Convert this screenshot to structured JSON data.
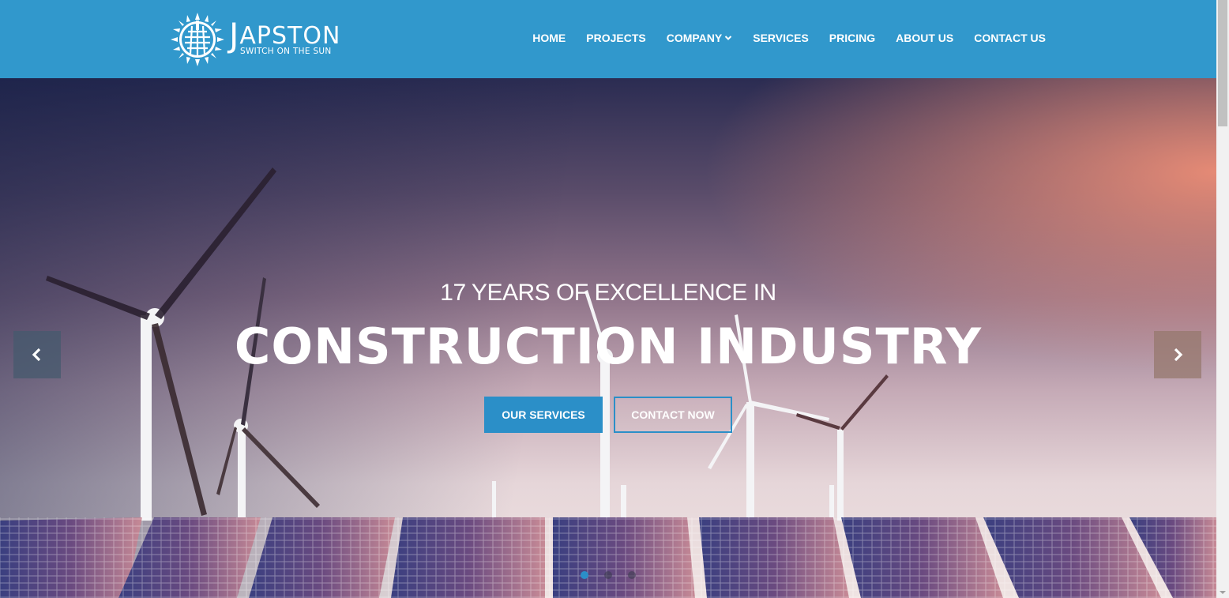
{
  "brand": {
    "name": "APSTON",
    "initial": "J",
    "tagline": "SWITCH ON THE SUN"
  },
  "nav": {
    "items": [
      {
        "label": "HOME"
      },
      {
        "label": "PROJECTS"
      },
      {
        "label": "COMPANY",
        "has_dropdown": true
      },
      {
        "label": "SERVICES"
      },
      {
        "label": "PRICING"
      },
      {
        "label": "ABOUT US"
      },
      {
        "label": "CONTACT US"
      }
    ]
  },
  "hero": {
    "pre_title": "17 YEARS OF EXCELLENCE IN",
    "title": "CONSTRUCTION INDUSTRY",
    "primary_button": "OUR SERVICES",
    "secondary_button": "CONTACT NOW",
    "slides_total": 3,
    "active_slide": 1
  },
  "colors": {
    "header_bg": "#3198cc",
    "accent": "#2b8fc8",
    "text_on_dark": "#ffffff"
  },
  "icons": {
    "logo": "sun-grid-logo-icon",
    "dropdown": "chevron-down-icon",
    "prev": "chevron-left-icon",
    "next": "chevron-right-icon"
  }
}
